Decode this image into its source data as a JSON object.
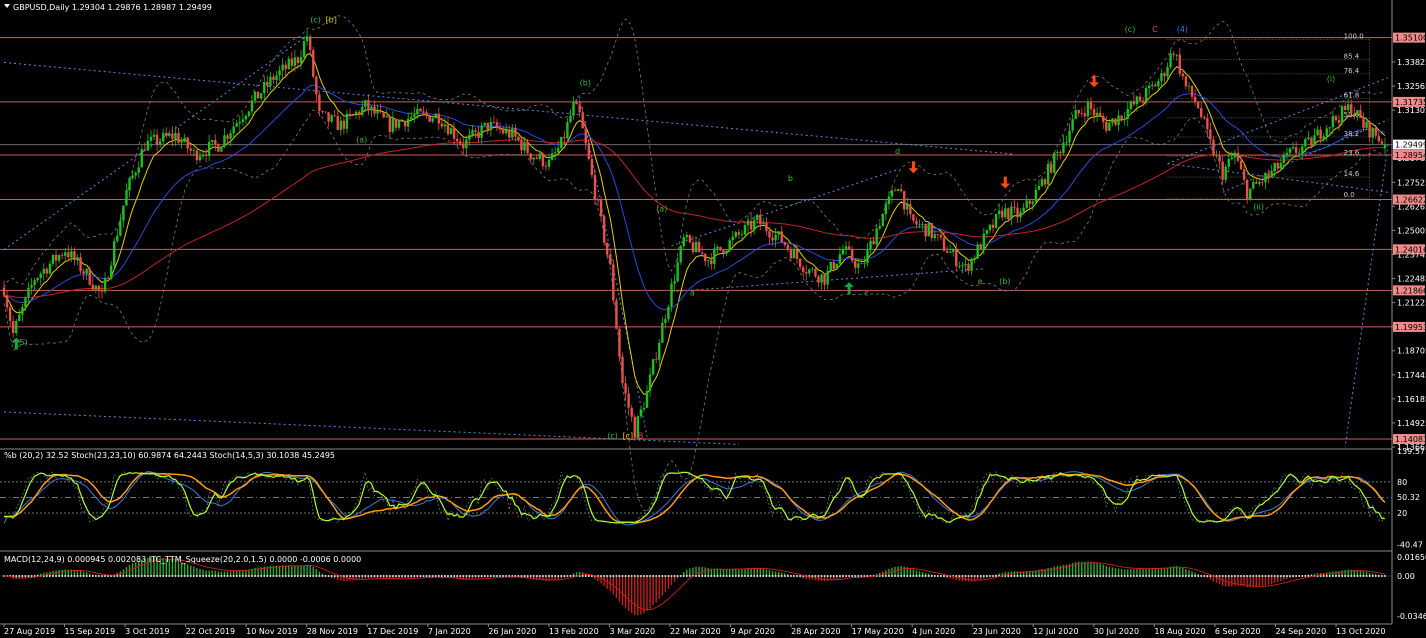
{
  "colors": {
    "background": "#000000",
    "bull": "#1fbf1f",
    "bear": "#e8504a",
    "hline": "#d05a5a",
    "ema_fast": "#e0d000",
    "ema_mid": "#2a4ad8",
    "ema_slow": "#c42424",
    "stoch_fast": "#a8ff2a",
    "stoch_slow": "#ff9a10",
    "pctb": "#3a7ad8",
    "axis": "#8a8a8a",
    "price_tag": "#f08a8a",
    "current_tag": "#ffffff",
    "macd_pos": "#2fa82f",
    "macd_neg": "#c42020",
    "arrow_down": "#ff4a10",
    "arrow_up": "#20a040"
  },
  "header": {
    "symbol_line": "GBPUSD,Daily  1.29304 1.29876 1.28987 1.29499",
    "menu_icon": "triangle-down-icon"
  },
  "chart_data": [
    {
      "type": "candlestick",
      "title": "GBPUSD,Daily",
      "ohlc_last": {
        "open": 1.29304,
        "high": 1.29876,
        "low": 1.28987,
        "close": 1.29499
      },
      "ylim": [
        1.13665,
        1.36285
      ],
      "y_ticks": [
        1.33825,
        1.32565,
        1.31305,
        1.28785,
        1.27525,
        1.26265,
        1.25005,
        1.23745,
        1.22485,
        1.21225,
        1.19965,
        1.18705,
        1.17445,
        1.16185,
        1.14925,
        1.13665
      ],
      "price_levels": [
        1.351,
        1.31735,
        1.28954,
        1.26622,
        1.24016,
        1.21866,
        1.19953,
        1.14083
      ],
      "current_price": 1.29499,
      "x_labels": [
        "27 Aug 2019",
        "15 Sep 2019",
        "3 Oct 2019",
        "22 Oct 2019",
        "10 Nov 2019",
        "28 Nov 2019",
        "17 Dec 2019",
        "7 Jan 2020",
        "26 Jan 2020",
        "13 Feb 2020",
        "3 Mar 2020",
        "22 Mar 2020",
        "9 Apr 2020",
        "28 Apr 2020",
        "17 May 2020",
        "4 Jun 2020",
        "23 Jun 2020",
        "12 Jul 2020",
        "30 Jul 2020",
        "18 Aug 2020",
        "6 Sep 2020",
        "24 Sep 2020",
        "13 Oct 2020"
      ],
      "swing_path": [
        [
          0,
          1.22
        ],
        [
          3,
          1.196
        ],
        [
          10,
          1.225
        ],
        [
          20,
          1.24
        ],
        [
          28,
          1.225
        ],
        [
          32,
          1.215
        ],
        [
          40,
          1.27
        ],
        [
          46,
          1.295
        ],
        [
          56,
          1.3
        ],
        [
          62,
          1.29
        ],
        [
          70,
          1.295
        ],
        [
          80,
          1.315
        ],
        [
          88,
          1.33
        ],
        [
          92,
          1.335
        ],
        [
          96,
          1.34
        ],
        [
          99,
          1.352
        ],
        [
          103,
          1.31
        ],
        [
          110,
          1.305
        ],
        [
          118,
          1.315
        ],
        [
          126,
          1.305
        ],
        [
          134,
          1.31
        ],
        [
          142,
          1.31
        ],
        [
          150,
          1.295
        ],
        [
          158,
          1.305
        ],
        [
          166,
          1.3
        ],
        [
          172,
          1.29
        ],
        [
          178,
          1.285
        ],
        [
          182,
          1.295
        ],
        [
          186,
          1.315
        ],
        [
          188,
          1.31
        ],
        [
          193,
          1.27
        ],
        [
          198,
          1.23
        ],
        [
          202,
          1.17
        ],
        [
          206,
          1.145
        ],
        [
          210,
          1.165
        ],
        [
          215,
          1.2
        ],
        [
          218,
          1.22
        ],
        [
          222,
          1.245
        ],
        [
          230,
          1.235
        ],
        [
          238,
          1.245
        ],
        [
          246,
          1.255
        ],
        [
          254,
          1.245
        ],
        [
          262,
          1.23
        ],
        [
          268,
          1.225
        ],
        [
          274,
          1.24
        ],
        [
          280,
          1.23
        ],
        [
          286,
          1.255
        ],
        [
          292,
          1.275
        ],
        [
          296,
          1.255
        ],
        [
          302,
          1.25
        ],
        [
          308,
          1.24
        ],
        [
          314,
          1.23
        ],
        [
          320,
          1.245
        ],
        [
          326,
          1.26
        ],
        [
          332,
          1.258
        ],
        [
          338,
          1.272
        ],
        [
          344,
          1.29
        ],
        [
          350,
          1.31
        ],
        [
          354,
          1.315
        ],
        [
          360,
          1.305
        ],
        [
          366,
          1.312
        ],
        [
          372,
          1.32
        ],
        [
          378,
          1.33
        ],
        [
          382,
          1.345
        ],
        [
          386,
          1.325
        ],
        [
          390,
          1.315
        ],
        [
          394,
          1.295
        ],
        [
          398,
          1.28
        ],
        [
          402,
          1.29
        ],
        [
          406,
          1.27
        ],
        [
          410,
          1.275
        ],
        [
          414,
          1.28
        ],
        [
          420,
          1.29
        ],
        [
          426,
          1.295
        ],
        [
          432,
          1.305
        ],
        [
          436,
          1.31
        ],
        [
          440,
          1.315
        ],
        [
          444,
          1.305
        ],
        [
          448,
          1.3
        ],
        [
          451,
          1.295
        ]
      ],
      "wave_labels": [
        {
          "text": "(c)",
          "color": "#2fbf2f",
          "i": 100,
          "price": 1.359
        },
        {
          "text": "[b]",
          "color": "#e0d000",
          "i": 105,
          "price": 1.359
        },
        {
          "text": "(b)",
          "color": "#2fbf2f",
          "i": 188,
          "price": 1.326
        },
        {
          "text": "(a)",
          "color": "#2fbf2f",
          "i": 115,
          "price": 1.296
        },
        {
          "text": "(c)",
          "color": "#2fbf2f",
          "i": 197,
          "price": 1.141
        },
        {
          "text": "[c]",
          "color": "#e0d000",
          "i": 202,
          "price": 1.141
        },
        {
          "text": "B",
          "color": "#e8504a",
          "i": 207,
          "price": 1.141
        },
        {
          "text": "(a)",
          "color": "#2fbf2f",
          "i": 213,
          "price": 1.26
        },
        {
          "text": "a",
          "color": "#2fbf2f",
          "i": 224,
          "price": 1.216
        },
        {
          "text": "b",
          "color": "#2fbf2f",
          "i": 256,
          "price": 1.276
        },
        {
          "text": "c",
          "color": "#2fbf2f",
          "i": 281,
          "price": 1.216
        },
        {
          "text": "d",
          "color": "#2fbf2f",
          "i": 291,
          "price": 1.29
        },
        {
          "text": "e",
          "color": "#2fbf2f",
          "i": 318,
          "price": 1.222
        },
        {
          "text": "(b)",
          "color": "#2fbf2f",
          "i": 325,
          "price": 1.222
        },
        {
          "text": "(c)",
          "color": "#2fbf2f",
          "i": 366,
          "price": 1.354
        },
        {
          "text": "C",
          "color": "#e8504a",
          "i": 375,
          "price": 1.354
        },
        {
          "text": "(4)",
          "color": "#3a7ad8",
          "i": 383,
          "price": 1.354
        },
        {
          "text": "(i)",
          "color": "#2fbf2f",
          "i": 432,
          "price": 1.328
        },
        {
          "text": "(ii)",
          "color": "#2fbf2f",
          "i": 408,
          "price": 1.261
        },
        {
          "text": "(5)",
          "color": "#2fbf2f",
          "i": 4,
          "price": 1.19
        }
      ],
      "arrows_down": [
        [
          297,
          1.28
        ],
        [
          327,
          1.272
        ],
        [
          356,
          1.325
        ]
      ],
      "arrows_up": [
        [
          4,
          1.194
        ],
        [
          276,
          1.223
        ]
      ],
      "fib_levels": [
        {
          "label": "100.0",
          "price": 1.35
        },
        {
          "label": "85.4",
          "price": 1.3395
        },
        {
          "label": "76.4",
          "price": 1.332
        },
        {
          "label": "61.8",
          "price": 1.319
        },
        {
          "label": "50.0",
          "price": 1.309
        },
        {
          "label": "38.2",
          "price": 1.299
        },
        {
          "label": "23.6",
          "price": 1.289
        },
        {
          "label": "14.6",
          "price": 1.278
        },
        {
          "label": "0.0",
          "price": 1.267
        }
      ]
    },
    {
      "type": "line",
      "title": "%b (20,2) 32.52  Stoch(23,23,10) 60.9874 64.2443  Stoch(14,5,3) 30.1038 45.2495",
      "ylim": [
        -49.5,
        139.5
      ],
      "y_ticks": [
        139.57,
        80,
        50.32,
        20,
        -40.47
      ],
      "guide_levels": [
        80,
        50,
        20
      ]
    },
    {
      "type": "bar",
      "title": "MACD(12,24,9) 0.000945 0.002083  ITC_TTM_Squeeze(20,2.0,1.5) 0.0000 -0.0006 0.0000",
      "ylim": [
        -0.04,
        0.02
      ],
      "y_ticks": [
        0.016502,
        0.0,
        -0.034699
      ]
    }
  ]
}
